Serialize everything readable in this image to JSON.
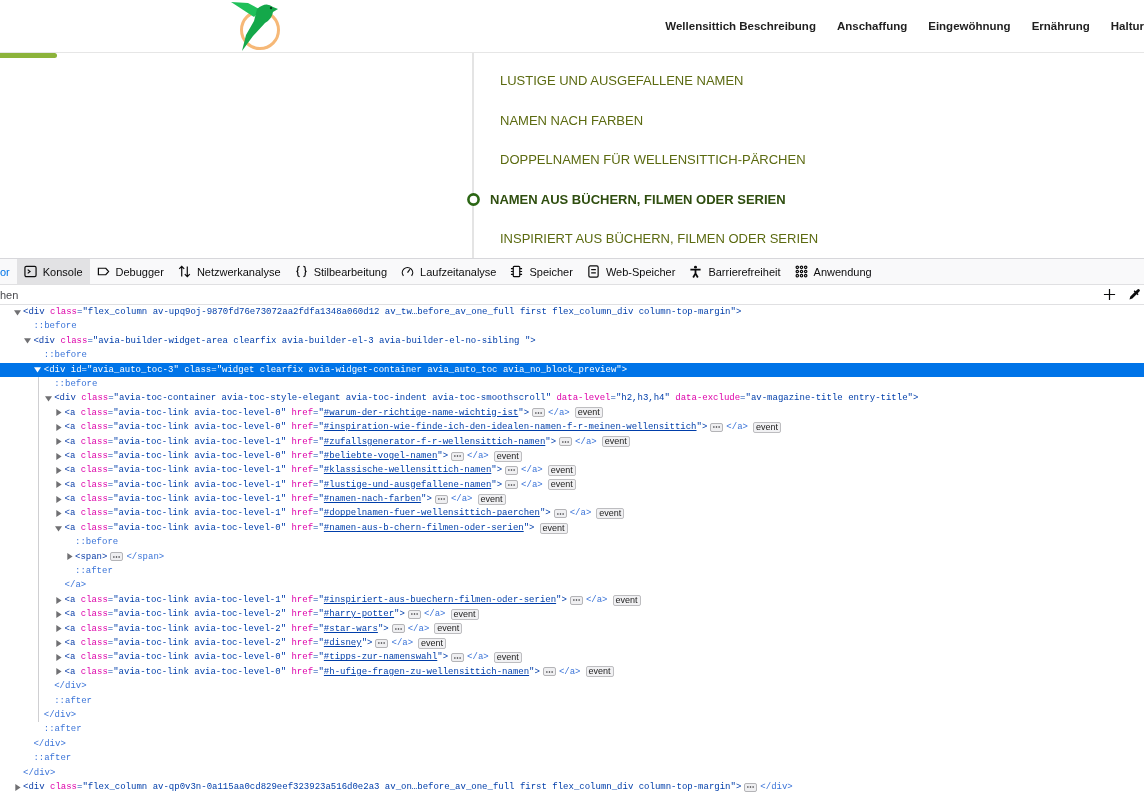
{
  "page": {
    "nav": [
      {
        "label": "Wellensittich Beschreibung"
      },
      {
        "label": "Anschaffung"
      },
      {
        "label": "Eingewöhnung"
      },
      {
        "label": "Ernährung"
      },
      {
        "label": "Haltur"
      }
    ],
    "reading_progress": {
      "level": 0.05
    },
    "toc": [
      {
        "label": "LUSTIGE UND AUSGEFALLENE NAMEN",
        "selected": false
      },
      {
        "label": "NAMEN NACH FARBEN",
        "selected": false
      },
      {
        "label": "DOPPELNAMEN FÜR WELLENSITTICH-PÄRCHEN",
        "selected": false
      },
      {
        "label": "NAMEN AUS BÜCHERN, FILMEN ODER SERIEN",
        "selected": true
      },
      {
        "label": "INSPIRIERT AUS BÜCHERN, FILMEN ODER SERIEN",
        "selected": false
      }
    ]
  },
  "devtools": {
    "tabs": [
      {
        "label": "or",
        "selected": true,
        "hovered": false
      },
      {
        "label": "Konsole",
        "kind": "console",
        "selected": false,
        "hovered": true
      },
      {
        "label": "Debugger",
        "kind": "debugger",
        "selected": false,
        "hovered": false
      },
      {
        "label": "Netzwerkanalyse",
        "kind": "network",
        "selected": false,
        "hovered": false
      },
      {
        "label": "Stilbearbeitung",
        "kind": "style",
        "selected": false,
        "hovered": false
      },
      {
        "label": "Laufzeitanalyse",
        "kind": "performance",
        "selected": false,
        "hovered": false
      },
      {
        "label": "Speicher",
        "kind": "memory",
        "selected": false,
        "hovered": false
      },
      {
        "label": "Web-Speicher",
        "kind": "storage",
        "selected": false,
        "hovered": false
      },
      {
        "label": "Barrierefreiheit",
        "kind": "accessibility",
        "selected": false,
        "hovered": false
      },
      {
        "label": "Anwendung",
        "kind": "application",
        "selected": false,
        "hovered": false
      }
    ],
    "search": {
      "placeholder": "hen"
    },
    "tree": [
      {
        "kind": "element",
        "selected": false,
        "expanded": true,
        "tokens": [
          {
            "kind": "tag",
            "text": "<div"
          },
          {
            "kind": "attr",
            "text": "class"
          },
          {
            "kind": "value",
            "text": "=\"flex_column av-upq9oj-9870fd76e73072aa2fdfa1348a060d12 av_tw…before_av_one_full first flex_column_div column-top-margin\">"
          }
        ],
        "close": "</div>",
        "children": [
          {
            "kind": "pseudo",
            "selected": false,
            "text": "::before"
          },
          {
            "kind": "element",
            "selected": false,
            "expanded": true,
            "tokens": [
              {
                "kind": "tag",
                "text": "<div"
              },
              {
                "kind": "attr",
                "text": "class"
              },
              {
                "kind": "value",
                "text": "=\"avia-builder-widget-area clearfix avia-builder-el-3 avia-builder-el-no-sibling \">"
              }
            ],
            "close": "</div>",
            "children": [
              {
                "kind": "pseudo",
                "selected": false,
                "text": "::before"
              },
              {
                "kind": "element",
                "selected": true,
                "expanded": true,
                "tokens": [
                  {
                    "kind": "tag",
                    "text": "<div"
                  },
                  {
                    "kind": "attr",
                    "text": "id"
                  },
                  {
                    "kind": "value",
                    "text": "=\"avia_auto_toc-3\""
                  },
                  {
                    "kind": "attr",
                    "text": "class"
                  },
                  {
                    "kind": "value",
                    "text": "=\"widget clearfix avia-widget-container avia_auto_toc avia_no_block_preview\">"
                  }
                ],
                "close": "</div>",
                "children": [
                  {
                    "kind": "pseudo",
                    "selected": false,
                    "text": "::before"
                  },
                  {
                    "kind": "element",
                    "selected": false,
                    "expanded": true,
                    "tokens": [
                      {
                        "kind": "tag",
                        "text": "<div"
                      },
                      {
                        "kind": "attr",
                        "text": "class"
                      },
                      {
                        "kind": "value",
                        "text": "=\"avia-toc-container avia-toc-style-elegant avia-toc-indent avia-toc-smoothscroll\""
                      },
                      {
                        "kind": "attr",
                        "text": "data-level"
                      },
                      {
                        "kind": "value",
                        "text": "=\"h2,h3,h4\""
                      },
                      {
                        "kind": "attr",
                        "text": "data-exclude"
                      },
                      {
                        "kind": "value",
                        "text": "=\"av-magazine-title entry-title\">"
                      }
                    ],
                    "close": "</div>",
                    "children": [
                      {
                        "kind": "element",
                        "selected": false,
                        "expanded": false,
                        "tokens": [
                          {
                            "kind": "tag",
                            "text": "<a"
                          },
                          {
                            "kind": "attr",
                            "text": "class"
                          },
                          {
                            "kind": "value",
                            "text": "=\"avia-toc-link avia-toc-level-0\""
                          },
                          {
                            "kind": "attr",
                            "text": "href"
                          },
                          {
                            "kind": "value",
                            "text": "=\""
                          },
                          {
                            "kind": "link",
                            "text": "#warum-der-richtige-name-wichtig-ist"
                          },
                          {
                            "kind": "value",
                            "text": "\">"
                          }
                        ],
                        "close": "</a>",
                        "event": "event"
                      },
                      {
                        "kind": "element",
                        "selected": false,
                        "expanded": false,
                        "tokens": [
                          {
                            "kind": "tag",
                            "text": "<a"
                          },
                          {
                            "kind": "attr",
                            "text": "class"
                          },
                          {
                            "kind": "value",
                            "text": "=\"avia-toc-link avia-toc-level-0\""
                          },
                          {
                            "kind": "attr",
                            "text": "href"
                          },
                          {
                            "kind": "value",
                            "text": "=\""
                          },
                          {
                            "kind": "link",
                            "text": "#inspiration-wie-finde-ich-den-idealen-namen-f-r-meinen-wellensittich"
                          },
                          {
                            "kind": "value",
                            "text": "\">"
                          }
                        ],
                        "close": "</a>",
                        "event": "event"
                      },
                      {
                        "kind": "element",
                        "selected": false,
                        "expanded": false,
                        "tokens": [
                          {
                            "kind": "tag",
                            "text": "<a"
                          },
                          {
                            "kind": "attr",
                            "text": "class"
                          },
                          {
                            "kind": "value",
                            "text": "=\"avia-toc-link avia-toc-level-1\""
                          },
                          {
                            "kind": "attr",
                            "text": "href"
                          },
                          {
                            "kind": "value",
                            "text": "=\""
                          },
                          {
                            "kind": "link",
                            "text": "#zufallsgenerator-f-r-wellensittich-namen"
                          },
                          {
                            "kind": "value",
                            "text": "\">"
                          }
                        ],
                        "close": "</a>",
                        "event": "event"
                      },
                      {
                        "kind": "element",
                        "selected": false,
                        "expanded": false,
                        "tokens": [
                          {
                            "kind": "tag",
                            "text": "<a"
                          },
                          {
                            "kind": "attr",
                            "text": "class"
                          },
                          {
                            "kind": "value",
                            "text": "=\"avia-toc-link avia-toc-level-0\""
                          },
                          {
                            "kind": "attr",
                            "text": "href"
                          },
                          {
                            "kind": "value",
                            "text": "=\""
                          },
                          {
                            "kind": "link",
                            "text": "#beliebte-vogel-namen"
                          },
                          {
                            "kind": "value",
                            "text": "\">"
                          }
                        ],
                        "close": "</a>",
                        "event": "event"
                      },
                      {
                        "kind": "element",
                        "selected": false,
                        "expanded": false,
                        "tokens": [
                          {
                            "kind": "tag",
                            "text": "<a"
                          },
                          {
                            "kind": "attr",
                            "text": "class"
                          },
                          {
                            "kind": "value",
                            "text": "=\"avia-toc-link avia-toc-level-1\""
                          },
                          {
                            "kind": "attr",
                            "text": "href"
                          },
                          {
                            "kind": "value",
                            "text": "=\""
                          },
                          {
                            "kind": "link",
                            "text": "#klassische-wellensittich-namen"
                          },
                          {
                            "kind": "value",
                            "text": "\">"
                          }
                        ],
                        "close": "</a>",
                        "event": "event"
                      },
                      {
                        "kind": "element",
                        "selected": false,
                        "expanded": false,
                        "tokens": [
                          {
                            "kind": "tag",
                            "text": "<a"
                          },
                          {
                            "kind": "attr",
                            "text": "class"
                          },
                          {
                            "kind": "value",
                            "text": "=\"avia-toc-link avia-toc-level-1\""
                          },
                          {
                            "kind": "attr",
                            "text": "href"
                          },
                          {
                            "kind": "value",
                            "text": "=\""
                          },
                          {
                            "kind": "link",
                            "text": "#lustige-und-ausgefallene-namen"
                          },
                          {
                            "kind": "value",
                            "text": "\">"
                          }
                        ],
                        "close": "</a>",
                        "event": "event"
                      },
                      {
                        "kind": "element",
                        "selected": false,
                        "expanded": false,
                        "tokens": [
                          {
                            "kind": "tag",
                            "text": "<a"
                          },
                          {
                            "kind": "attr",
                            "text": "class"
                          },
                          {
                            "kind": "value",
                            "text": "=\"avia-toc-link avia-toc-level-1\""
                          },
                          {
                            "kind": "attr",
                            "text": "href"
                          },
                          {
                            "kind": "value",
                            "text": "=\""
                          },
                          {
                            "kind": "link",
                            "text": "#namen-nach-farben"
                          },
                          {
                            "kind": "value",
                            "text": "\">"
                          }
                        ],
                        "close": "</a>",
                        "event": "event"
                      },
                      {
                        "kind": "element",
                        "selected": false,
                        "expanded": false,
                        "tokens": [
                          {
                            "kind": "tag",
                            "text": "<a"
                          },
                          {
                            "kind": "attr",
                            "text": "class"
                          },
                          {
                            "kind": "value",
                            "text": "=\"avia-toc-link avia-toc-level-1\""
                          },
                          {
                            "kind": "attr",
                            "text": "href"
                          },
                          {
                            "kind": "value",
                            "text": "=\""
                          },
                          {
                            "kind": "link",
                            "text": "#doppelnamen-fuer-wellensittich-paerchen"
                          },
                          {
                            "kind": "value",
                            "text": "\">"
                          }
                        ],
                        "close": "</a>",
                        "event": "event"
                      },
                      {
                        "kind": "element",
                        "selected": false,
                        "expanded": true,
                        "tokens": [
                          {
                            "kind": "tag",
                            "text": "<a"
                          },
                          {
                            "kind": "attr",
                            "text": "class"
                          },
                          {
                            "kind": "value",
                            "text": "=\"avia-toc-link avia-toc-level-0\""
                          },
                          {
                            "kind": "attr",
                            "text": "href"
                          },
                          {
                            "kind": "value",
                            "text": "=\""
                          },
                          {
                            "kind": "link",
                            "text": "#namen-aus-b-chern-filmen-oder-serien"
                          },
                          {
                            "kind": "value",
                            "text": "\">"
                          }
                        ],
                        "event": "event",
                        "close": "</a>",
                        "children": [
                          {
                            "kind": "pseudo",
                            "selected": false,
                            "text": "::before"
                          },
                          {
                            "kind": "element",
                            "selected": false,
                            "expanded": false,
                            "tokens": [
                              {
                                "kind": "tag",
                                "text": "<span>"
                              }
                            ],
                            "close": "</span>"
                          },
                          {
                            "kind": "pseudo",
                            "selected": false,
                            "text": "::after"
                          }
                        ]
                      },
                      {
                        "kind": "element",
                        "selected": false,
                        "expanded": false,
                        "tokens": [
                          {
                            "kind": "tag",
                            "text": "<a"
                          },
                          {
                            "kind": "attr",
                            "text": "class"
                          },
                          {
                            "kind": "value",
                            "text": "=\"avia-toc-link avia-toc-level-1\""
                          },
                          {
                            "kind": "attr",
                            "text": "href"
                          },
                          {
                            "kind": "value",
                            "text": "=\""
                          },
                          {
                            "kind": "link",
                            "text": "#inspiriert-aus-buechern-filmen-oder-serien"
                          },
                          {
                            "kind": "value",
                            "text": "\">"
                          }
                        ],
                        "close": "</a>",
                        "event": "event"
                      },
                      {
                        "kind": "element",
                        "selected": false,
                        "expanded": false,
                        "tokens": [
                          {
                            "kind": "tag",
                            "text": "<a"
                          },
                          {
                            "kind": "attr",
                            "text": "class"
                          },
                          {
                            "kind": "value",
                            "text": "=\"avia-toc-link avia-toc-level-2\""
                          },
                          {
                            "kind": "attr",
                            "text": "href"
                          },
                          {
                            "kind": "value",
                            "text": "=\""
                          },
                          {
                            "kind": "link",
                            "text": "#harry-potter"
                          },
                          {
                            "kind": "value",
                            "text": "\">"
                          }
                        ],
                        "close": "</a>",
                        "event": "event"
                      },
                      {
                        "kind": "element",
                        "selected": false,
                        "expanded": false,
                        "tokens": [
                          {
                            "kind": "tag",
                            "text": "<a"
                          },
                          {
                            "kind": "attr",
                            "text": "class"
                          },
                          {
                            "kind": "value",
                            "text": "=\"avia-toc-link avia-toc-level-2\""
                          },
                          {
                            "kind": "attr",
                            "text": "href"
                          },
                          {
                            "kind": "value",
                            "text": "=\""
                          },
                          {
                            "kind": "link",
                            "text": "#star-wars"
                          },
                          {
                            "kind": "value",
                            "text": "\">"
                          }
                        ],
                        "close": "</a>",
                        "event": "event"
                      },
                      {
                        "kind": "element",
                        "selected": false,
                        "expanded": false,
                        "tokens": [
                          {
                            "kind": "tag",
                            "text": "<a"
                          },
                          {
                            "kind": "attr",
                            "text": "class"
                          },
                          {
                            "kind": "value",
                            "text": "=\"avia-toc-link avia-toc-level-2\""
                          },
                          {
                            "kind": "attr",
                            "text": "href"
                          },
                          {
                            "kind": "value",
                            "text": "=\""
                          },
                          {
                            "kind": "link",
                            "text": "#disney"
                          },
                          {
                            "kind": "value",
                            "text": "\">"
                          }
                        ],
                        "close": "</a>",
                        "event": "event"
                      },
                      {
                        "kind": "element",
                        "selected": false,
                        "expanded": false,
                        "tokens": [
                          {
                            "kind": "tag",
                            "text": "<a"
                          },
                          {
                            "kind": "attr",
                            "text": "class"
                          },
                          {
                            "kind": "value",
                            "text": "=\"avia-toc-link avia-toc-level-0\""
                          },
                          {
                            "kind": "attr",
                            "text": "href"
                          },
                          {
                            "kind": "value",
                            "text": "=\""
                          },
                          {
                            "kind": "link",
                            "text": "#tipps-zur-namenswahl"
                          },
                          {
                            "kind": "value",
                            "text": "\">"
                          }
                        ],
                        "close": "</a>",
                        "event": "event"
                      },
                      {
                        "kind": "element",
                        "selected": false,
                        "expanded": false,
                        "tokens": [
                          {
                            "kind": "tag",
                            "text": "<a"
                          },
                          {
                            "kind": "attr",
                            "text": "class"
                          },
                          {
                            "kind": "value",
                            "text": "=\"avia-toc-link avia-toc-level-0\""
                          },
                          {
                            "kind": "attr",
                            "text": "href"
                          },
                          {
                            "kind": "value",
                            "text": "=\""
                          },
                          {
                            "kind": "link",
                            "text": "#h-ufige-fragen-zu-wellensittich-namen"
                          },
                          {
                            "kind": "value",
                            "text": "\">"
                          }
                        ],
                        "close": "</a>",
                        "event": "event"
                      }
                    ]
                  },
                  {
                    "kind": "pseudo",
                    "selected": false,
                    "text": "::after"
                  }
                ]
              },
              {
                "kind": "pseudo",
                "selected": false,
                "text": "::after"
              }
            ]
          },
          {
            "kind": "pseudo",
            "selected": false,
            "text": "::after"
          }
        ]
      },
      {
        "kind": "element",
        "selected": false,
        "expanded": false,
        "tokens": [
          {
            "kind": "tag",
            "text": "<div"
          },
          {
            "kind": "attr",
            "text": "class"
          },
          {
            "kind": "value",
            "text": "=\"flex_column av-qp0v3n-0a115aa0cd829eef323923a516d0e2a3 av_on…before_av_one_full first flex_column_div column-top-margin\">"
          }
        ],
        "close": "</div>"
      }
    ]
  }
}
